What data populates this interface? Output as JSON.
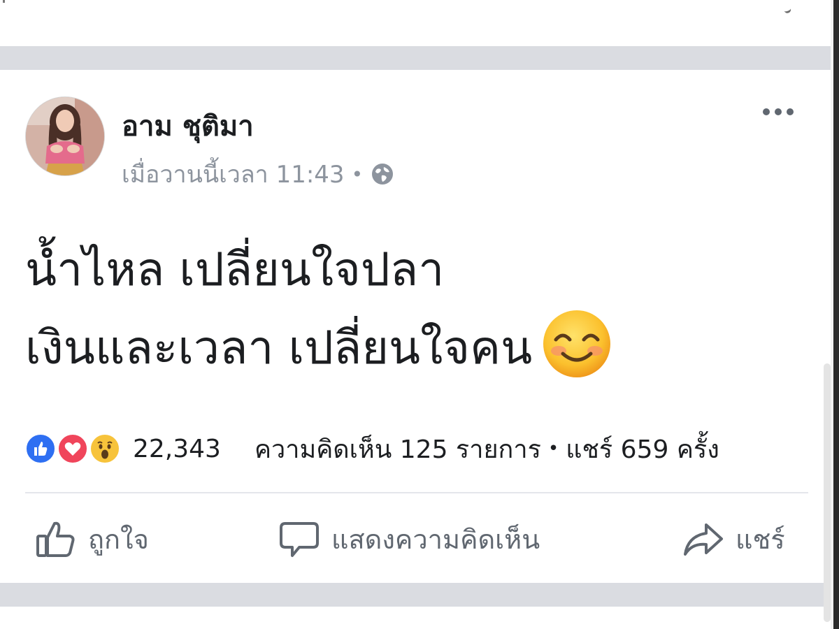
{
  "post": {
    "author": "อาม ชุติมา",
    "timestamp": "เมื่อวานนี้เวลา 11:43",
    "meta_separator": "•",
    "privacy_icon": "globe-icon",
    "more_icon": "more-options-icon",
    "content_lines": [
      "น้ำไหล เปลี่ยนใจปลา",
      "เงินและเวลา เปลี่ยนใจคน"
    ],
    "content_emoji": "smiling-face-emoji"
  },
  "stats": {
    "reaction_icons": [
      "like-reaction-icon",
      "love-reaction-icon",
      "wow-reaction-icon"
    ],
    "reaction_count": "22,343",
    "comments": "ความคิดเห็น 125 รายการ",
    "separator": "•",
    "shares": "แชร์ 659 ครั้ง"
  },
  "actions": {
    "like_label": "ถูกใจ",
    "comment_label": "แสดงความคิดเห็น",
    "share_label": "แชร์"
  },
  "colors": {
    "like_blue": "#2e6ff2",
    "love_red": "#f0455b",
    "wow_yellow": "#f7c33b",
    "meta_gray": "#8d949e",
    "action_gray": "#606770",
    "feed_gap": "#dadce1"
  }
}
